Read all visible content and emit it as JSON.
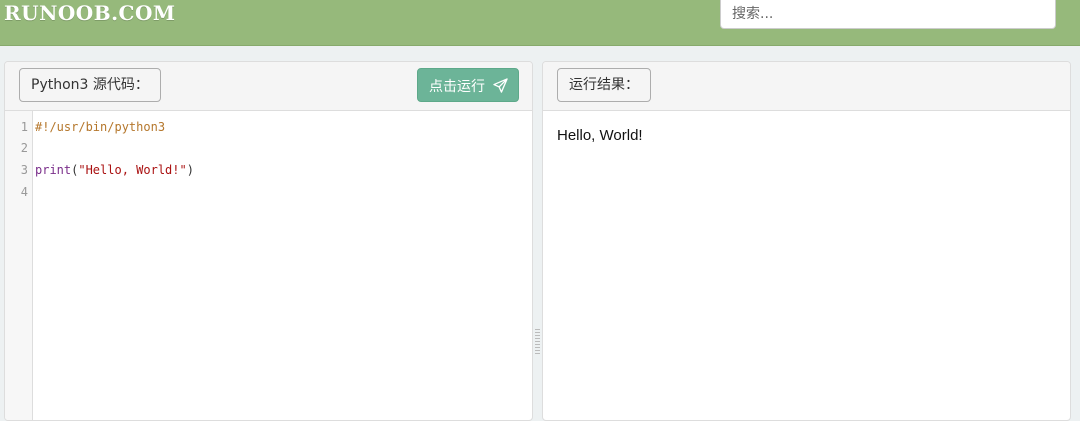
{
  "header": {
    "logo": "RUNOOB.COM",
    "search_placeholder": "搜索..."
  },
  "editor_panel": {
    "label": "Python3 源代码：",
    "run_button": "点击运行",
    "line_numbers": [
      "1",
      "2",
      "3",
      "4"
    ],
    "code": {
      "line1": "#!/usr/bin/python3",
      "line3_func": "print",
      "line3_open": "(",
      "line3_string": "\"Hello, World!\"",
      "line3_close": ")"
    }
  },
  "result_panel": {
    "label": "运行结果：",
    "output": "Hello, World!"
  },
  "colors": {
    "header_bg": "#96b97b",
    "run_button_bg": "#6cb498",
    "page_bg": "#edf1f2"
  }
}
